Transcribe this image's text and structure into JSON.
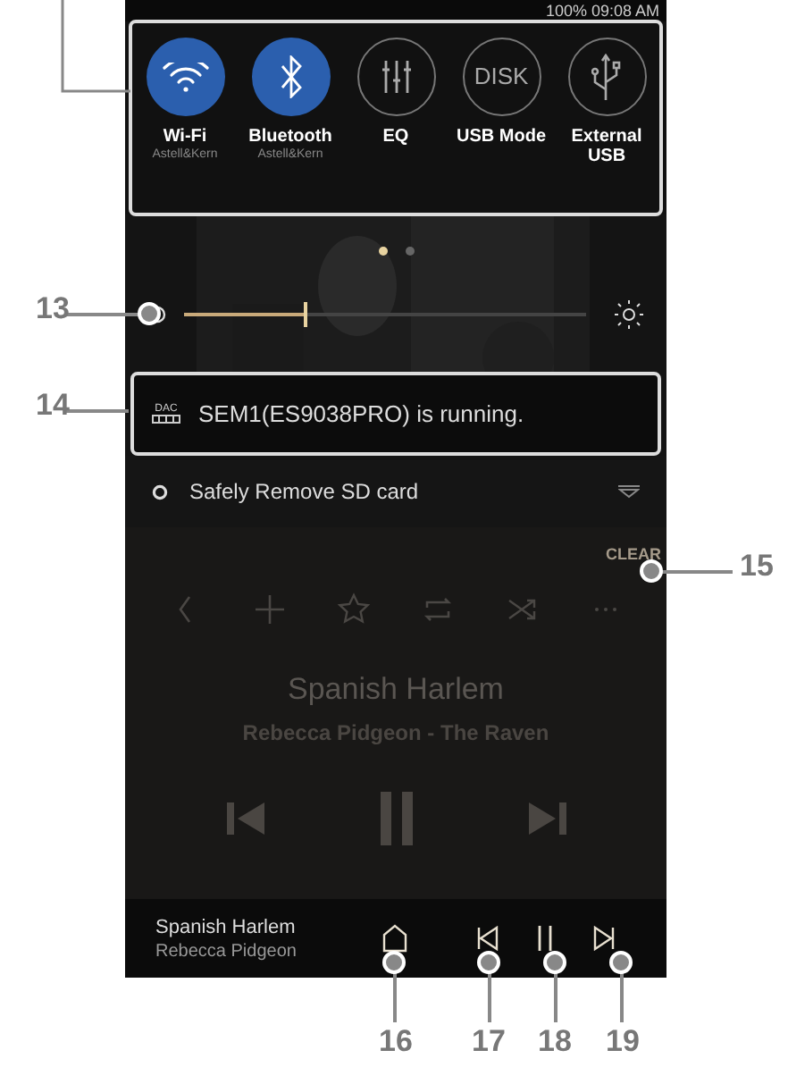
{
  "status_bar": {
    "text": "100% 09:08 AM"
  },
  "quick_settings": [
    {
      "kind": "wifi",
      "label": "Wi-Fi",
      "sublabel": "Astell&Kern",
      "on": true
    },
    {
      "kind": "bluetooth",
      "label": "Bluetooth",
      "sublabel": "Astell&Kern",
      "on": true
    },
    {
      "kind": "eq",
      "label": "EQ",
      "on": false
    },
    {
      "kind": "disk",
      "label": "USB Mode",
      "icon_text": "DISK",
      "on": false
    },
    {
      "kind": "usb",
      "label": "External USB",
      "on": false
    }
  ],
  "page_dots": [
    {
      "selected": true
    },
    {
      "selected": false
    }
  ],
  "brightness": {
    "level": 0.3
  },
  "notification": {
    "icon_text": "DAC",
    "message": "SEM1(ES9038PRO) is running."
  },
  "sd_card": {
    "label": "Safely Remove SD card"
  },
  "clear_button": {
    "label": "CLEAR"
  },
  "player": {
    "title": "Spanish Harlem",
    "subtitle": "Rebecca Pidgeon - The Raven"
  },
  "mini_player": {
    "title": "Spanish Harlem",
    "artist": "Rebecca Pidgeon"
  },
  "callouts": [
    {
      "number": "13"
    },
    {
      "number": "14"
    },
    {
      "number": "15"
    },
    {
      "number": "16"
    },
    {
      "number": "17"
    },
    {
      "number": "18"
    },
    {
      "number": "19"
    }
  ]
}
